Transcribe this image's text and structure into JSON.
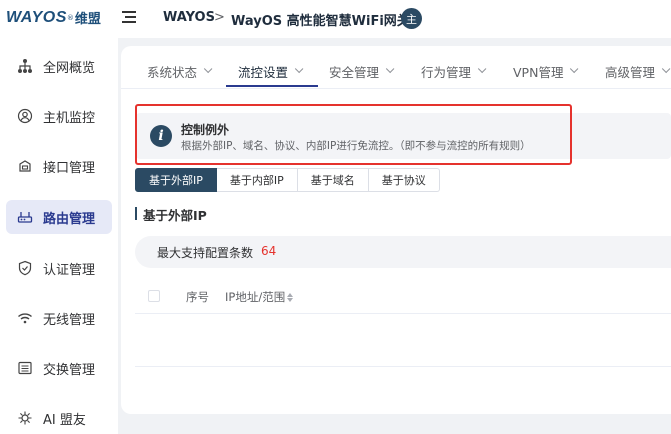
{
  "header": {
    "logo_main": "WAYOS",
    "logo_reg": "®",
    "logo_cn": "维盟",
    "breadcrumb_1": "WAYOS",
    "breadcrumb_sep": ">",
    "breadcrumb_2": "WayOS 高性能智慧WiFi网关",
    "avatar_text": "主"
  },
  "sidebar": {
    "items": [
      {
        "label": "全网概览",
        "icon": "network-topology-icon"
      },
      {
        "label": "主机监控",
        "icon": "user-circle-icon"
      },
      {
        "label": "接口管理",
        "icon": "interface-port-icon"
      },
      {
        "label": "路由管理",
        "icon": "router-icon",
        "active": true
      },
      {
        "label": "认证管理",
        "icon": "shield-check-icon"
      },
      {
        "label": "无线管理",
        "icon": "wifi-icon"
      },
      {
        "label": "交换管理",
        "icon": "switch-icon"
      },
      {
        "label": "AI 盟友",
        "icon": "ai-icon"
      }
    ]
  },
  "tabs": [
    {
      "label": "系统状态"
    },
    {
      "label": "流控设置",
      "active": true
    },
    {
      "label": "安全管理"
    },
    {
      "label": "行为管理"
    },
    {
      "label": "VPN管理"
    },
    {
      "label": "高级管理"
    }
  ],
  "info": {
    "title": "控制例外",
    "description": "根据外部IP、域名、协议、内部IP进行免流控。（即不参与流控的所有规则）"
  },
  "subtabs": [
    "基于外部IP",
    "基于内部IP",
    "基于域名",
    "基于协议"
  ],
  "section": {
    "title": "基于外部IP",
    "limit_label": "最大支持配置条数",
    "limit_value": "64"
  },
  "table": {
    "columns": [
      "序号",
      "IP地址/范围"
    ]
  },
  "colors": {
    "accent": "#2b4a63",
    "active_nav_bg": "#e6e9f7",
    "highlight": "#e5322d"
  }
}
